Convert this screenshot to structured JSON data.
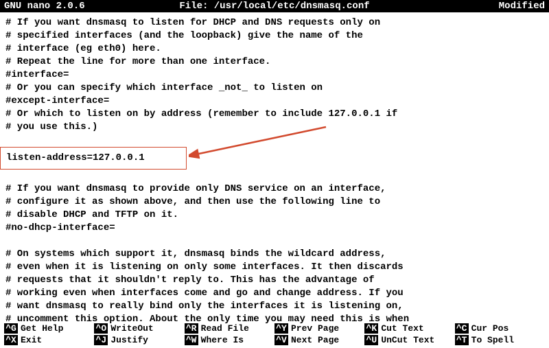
{
  "titlebar": {
    "app": "GNU nano 2.0.6",
    "file_label": "File: /usr/local/etc/dnsmasq.conf",
    "status": "Modified"
  },
  "lines": [
    "# If you want dnsmasq to listen for DHCP and DNS requests only on",
    "# specified interfaces (and the loopback) give the name of the",
    "# interface (eg eth0) here.",
    "# Repeat the line for more than one interface.",
    "#interface=",
    "# Or you can specify which interface _not_ to listen on",
    "#except-interface=",
    "# Or which to listen on by address (remember to include 127.0.0.1 if",
    "# you use this.)",
    "",
    "listen-address=127.0.0.1",
    "",
    "# If you want dnsmasq to provide only DNS service on an interface,",
    "# configure it as shown above, and then use the following line to",
    "# disable DHCP and TFTP on it.",
    "#no-dhcp-interface=",
    "",
    "# On systems which support it, dnsmasq binds the wildcard address,",
    "# even when it is listening on only some interfaces. It then discards",
    "# requests that it shouldn't reply to. This has the advantage of",
    "# working even when interfaces come and go and change address. If you",
    "# want dnsmasq to really bind only the interfaces it is listening on,",
    "# uncomment this option. About the only time you may need this is when"
  ],
  "highlight_index": 10,
  "menu": [
    {
      "key": "^G",
      "label": "Get Help"
    },
    {
      "key": "^O",
      "label": "WriteOut"
    },
    {
      "key": "^R",
      "label": "Read File"
    },
    {
      "key": "^Y",
      "label": "Prev Page"
    },
    {
      "key": "^K",
      "label": "Cut Text"
    },
    {
      "key": "^C",
      "label": "Cur Pos"
    },
    {
      "key": "^X",
      "label": "Exit"
    },
    {
      "key": "^J",
      "label": "Justify"
    },
    {
      "key": "^W",
      "label": "Where Is"
    },
    {
      "key": "^V",
      "label": "Next Page"
    },
    {
      "key": "^U",
      "label": "UnCut Text"
    },
    {
      "key": "^T",
      "label": "To Spell"
    }
  ],
  "annotation": {
    "arrow_color": "#d24a2e"
  }
}
